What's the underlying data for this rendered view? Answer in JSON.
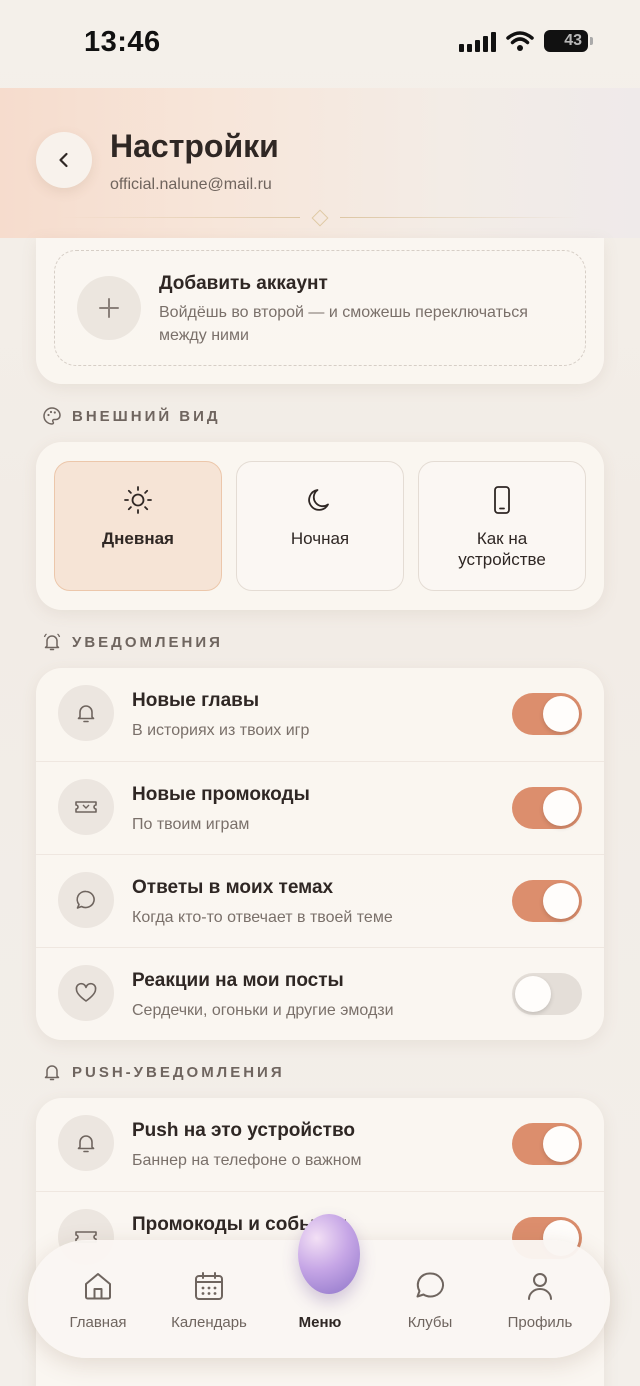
{
  "status_bar": {
    "time": "13:46",
    "battery": "43"
  },
  "header": {
    "title": "Настройки",
    "email": "official.nalune@mail.ru",
    "back_icon": "chevron-left-icon"
  },
  "add_account": {
    "title": "Добавить аккаунт",
    "description": "Войдёшь во второй — и сможешь переключаться между ними",
    "icon": "plus-icon"
  },
  "appearance": {
    "section_label": "ВНЕШНИЙ ВИД",
    "options": [
      {
        "label": "Дневная",
        "icon": "sun-icon",
        "selected": true
      },
      {
        "label": "Ночная",
        "icon": "moon-icon",
        "selected": false
      },
      {
        "label": "Как на устройстве",
        "icon": "phone-icon",
        "selected": false
      }
    ]
  },
  "notifications": {
    "section_label": "УВЕДОМЛЕНИЯ",
    "items": [
      {
        "title": "Новые главы",
        "subtitle": "В историях из твоих игр",
        "icon": "bell-icon",
        "enabled": true
      },
      {
        "title": "Новые промокоды",
        "subtitle": "По твоим играм",
        "icon": "ticket-icon",
        "enabled": true
      },
      {
        "title": "Ответы в моих темах",
        "subtitle": "Когда кто-то отвечает в твоей теме",
        "icon": "chat-bubble-icon",
        "enabled": true
      },
      {
        "title": "Реакции на мои посты",
        "subtitle": "Сердечки, огоньки и другие эмодзи",
        "icon": "heart-icon",
        "enabled": false
      }
    ]
  },
  "push": {
    "section_label": "PUSH-УВЕДОМЛЕНИЯ",
    "items": [
      {
        "title": "Push на это устройство",
        "subtitle": "Баннер на телефоне о важном",
        "icon": "bell-icon",
        "enabled": true
      },
      {
        "title": "Промокоды и события",
        "subtitle": "",
        "icon": "ticket-icon",
        "enabled": true
      }
    ]
  },
  "tabbar": {
    "tabs": [
      {
        "label": "Главная",
        "icon": "home-icon"
      },
      {
        "label": "Календарь",
        "icon": "calendar-icon"
      },
      {
        "label": "Меню",
        "icon": "orb-icon"
      },
      {
        "label": "Клубы",
        "icon": "chat-bubble-icon"
      },
      {
        "label": "Профиль",
        "icon": "user-icon"
      }
    ]
  },
  "colors": {
    "accent": "#dc8e6d",
    "background": "#f3efea",
    "text": "#2f2724"
  }
}
